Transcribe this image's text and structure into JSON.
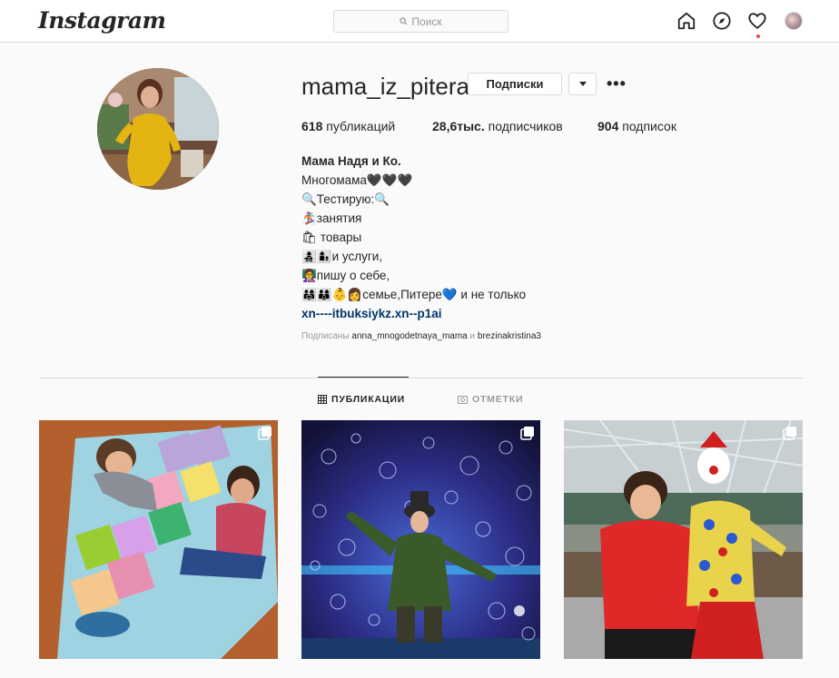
{
  "nav": {
    "logo": "Instagram",
    "search_placeholder": "Поиск",
    "icons": [
      "home-icon",
      "explore-icon",
      "heart-icon",
      "profile-avatar"
    ]
  },
  "profile": {
    "username": "mama_iz_pitera",
    "follow_button": "Подписки",
    "stats": {
      "posts_count": "618",
      "posts_label": " публикаций",
      "followers_count": "28,6тыс.",
      "followers_label": " подписчиков",
      "following_count": "904",
      "following_label": " подписок"
    },
    "bio": {
      "name": "Мама Надя и Ко.",
      "lines": [
        "Многомама🖤🖤🖤",
        "🔍Тестирую:🔍",
        "🏂занятия",
        "🛍 товары",
        "👩‍👧‍👦👩‍👦и услуги,",
        "👩‍🏫пишу о себе,",
        "👨‍👩‍👧👨‍👩‍👦👶👩семье,Питере💙 и не только"
      ],
      "link": "xn----itbuksiykz.xn--p1ai"
    },
    "followed_by": {
      "prefix": "Подписаны ",
      "user1": "anna_mnogodetnaya_mama",
      "joiner": " и ",
      "user2": "brezinakristina3"
    }
  },
  "tabs": {
    "posts": "ПУБЛИКАЦИИ",
    "tagged": "ОТМЕТКИ"
  },
  "posts": [
    {
      "type": "carousel",
      "subject": "kids-on-hopscotch-rug"
    },
    {
      "type": "carousel",
      "subject": "bubble-show-performer"
    },
    {
      "type": "carousel",
      "subject": "woman-with-clown-statue"
    }
  ],
  "colors": {
    "link": "#003569",
    "accent_dot": "#ed4956",
    "border": "#dbdbdb",
    "muted": "#999999"
  }
}
